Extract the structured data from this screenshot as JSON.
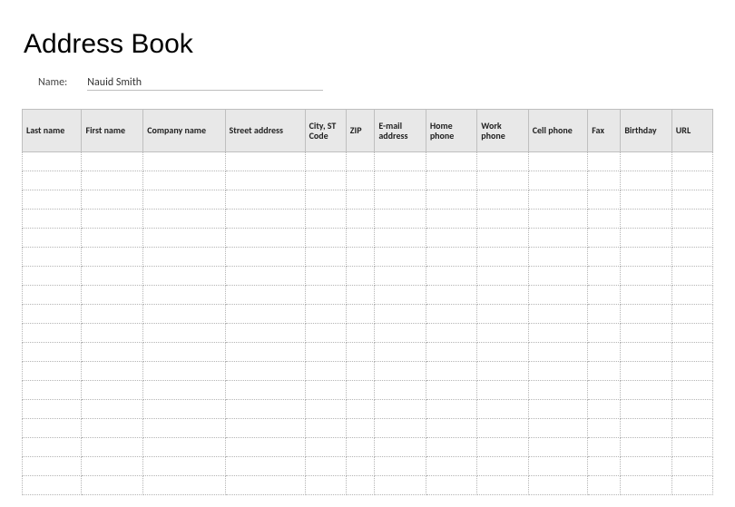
{
  "title": "Address Book",
  "name_label": "Name:",
  "name_value": "Nauid Smith",
  "columns": [
    "Last name",
    "First name",
    "Company name",
    "Street address",
    "City, ST Code",
    "ZIP",
    "E-mail address",
    "Home phone",
    "Work phone",
    "Cell phone",
    "Fax",
    "Birthday",
    "URL"
  ],
  "row_count": 18
}
